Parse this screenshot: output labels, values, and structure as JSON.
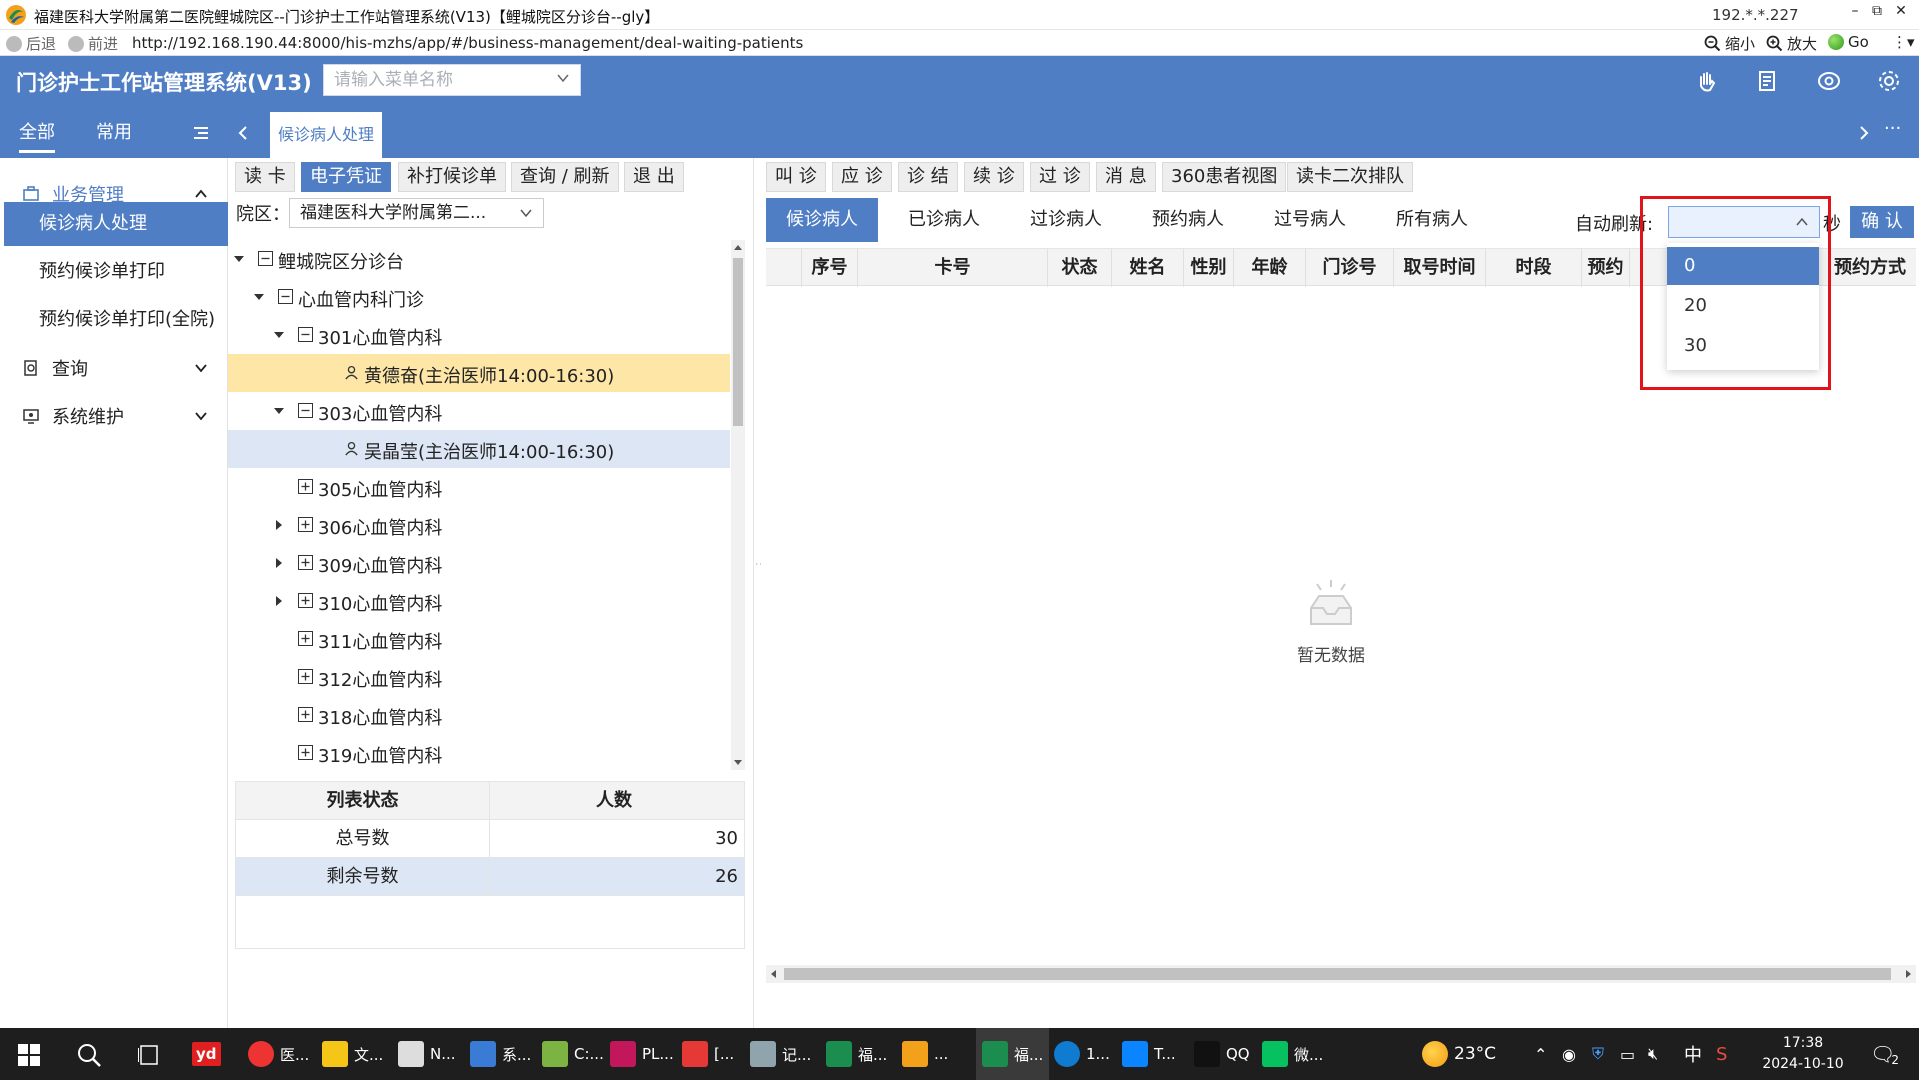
{
  "window": {
    "title": "福建医科大学附属第二医院鲤城院区--门诊护士工作站管理系统(V13)【鲤城院区分诊台--gly】",
    "ip": "192.*.*.227",
    "controls": [
      "–",
      "⧉",
      "✕"
    ]
  },
  "browser": {
    "back": "后退",
    "forward": "前进",
    "url": "http://192.168.190.44:8000/his-mzhs/app/#/business-management/deal-waiting-patients",
    "zoom_out": "缩小",
    "zoom_in": "放大",
    "go": "Go"
  },
  "header": {
    "app_title": "门诊护士工作站管理系统(V13)",
    "menu_search_placeholder": "请输入菜单名称",
    "tabs": {
      "all": "全部",
      "common": "常用"
    },
    "open_tab": "候诊病人处理"
  },
  "leftnav": {
    "groups": [
      {
        "label": "业务管理",
        "icon": "briefcase-icon",
        "expanded": true
      },
      {
        "label": "查询",
        "icon": "search-doc-icon",
        "expanded": false
      },
      {
        "label": "系统维护",
        "icon": "monitor-icon",
        "expanded": false
      }
    ],
    "items": [
      "候诊病人处理",
      "预约候诊单打印",
      "预约候诊单打印(全院)"
    ]
  },
  "toolbar_left": [
    "读 卡",
    "电子凭证",
    "补打候诊单",
    "查询 / 刷新",
    "退 出"
  ],
  "toolbar_right": [
    "叫 诊",
    "应 诊",
    "诊 结",
    "续 诊",
    "过 诊",
    "消 息",
    "360患者视图",
    "读卡二次排队"
  ],
  "yuanqu": {
    "label": "院区：",
    "value": "福建医科大学附属第二..."
  },
  "tree": [
    {
      "label": "鲤城院区分诊台",
      "level": 0
    },
    {
      "label": "心血管内科门诊",
      "level": 1
    },
    {
      "label": "301心血管内科",
      "level": 2
    },
    {
      "label": "黄德奋(主治医师14:00-16:30)",
      "level": 3,
      "selected": true
    },
    {
      "label": "303心血管内科",
      "level": 2
    },
    {
      "label": "吴晶莹(主治医师14:00-16:30)",
      "level": 3,
      "hover": true
    },
    {
      "label": "305心血管内科",
      "level": 2
    },
    {
      "label": "306心血管内科",
      "level": 2
    },
    {
      "label": "309心血管内科",
      "level": 2
    },
    {
      "label": "310心血管内科",
      "level": 2
    },
    {
      "label": "311心血管内科",
      "level": 2
    },
    {
      "label": "312心血管内科",
      "level": 2
    },
    {
      "label": "318心血管内科",
      "level": 2
    },
    {
      "label": "319心血管内科",
      "level": 2
    }
  ],
  "stats": {
    "headers": [
      "列表状态",
      "人数"
    ],
    "rows": [
      {
        "label": "总号数",
        "value": "30"
      },
      {
        "label": "剩余号数",
        "value": "26"
      }
    ]
  },
  "patient_tabs": [
    "候诊病人",
    "已诊病人",
    "过诊病人",
    "预约病人",
    "过号病人",
    "所有病人"
  ],
  "auto_refresh": {
    "label": "自动刷新:",
    "unit": "秒",
    "confirm": "确 认",
    "options": [
      "0",
      "20",
      "30"
    ],
    "selected": "0"
  },
  "grid": {
    "columns": [
      "序号",
      "卡号",
      "状态",
      "姓名",
      "性别",
      "年龄",
      "门诊号",
      "取号时间",
      "时段",
      "预约",
      "预约方式"
    ],
    "empty_text": "暂无数据"
  },
  "taskbar": {
    "apps": [
      "医...",
      "文...",
      "N...",
      "系...",
      "C:...",
      "PL...",
      "[...",
      "记...",
      "福...",
      "...",
      "福...",
      "1...",
      "T...",
      "QQ",
      "微..."
    ],
    "weather": "23°C",
    "ime": "中",
    "time": "17:38",
    "date": "2024-10-10",
    "notifications": "2"
  }
}
